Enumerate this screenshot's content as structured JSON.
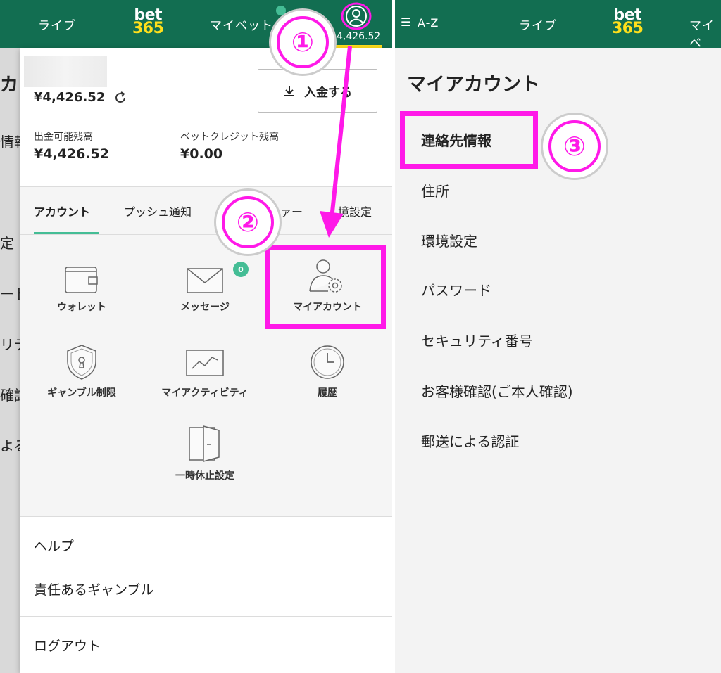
{
  "left": {
    "nav": {
      "live": "ライブ",
      "mybets": "マイベット",
      "logo_top": "bet",
      "logo_bottom": "365",
      "balance": "4,426.52"
    },
    "background_text": [
      "カウ",
      "情報",
      "定",
      "ード",
      "リテ",
      "確認",
      "よる"
    ],
    "panel": {
      "main_balance": "¥4,426.52",
      "deposit_label": "入金する",
      "withdrawable_label": "出金可能残高",
      "withdrawable_value": "¥4,426.52",
      "bet_credit_label": "ベットクレジット残高",
      "bet_credit_value": "¥0.00",
      "tabs": [
        "アカウント",
        "プッシュ通知",
        "ァー",
        "境設定"
      ],
      "tiles": {
        "wallet": "ウォレット",
        "messages": "メッセージ",
        "message_count": "0",
        "my_account": "マイアカウント",
        "gambling_limits": "ギャンブル制限",
        "my_activity": "マイアクティビティ",
        "history": "履歴",
        "time_out": "一時休止設定"
      },
      "help": "ヘルプ",
      "responsible_gambling": "責任あるギャンブル",
      "logout": "ログアウト"
    }
  },
  "right": {
    "nav": {
      "az": "A-Z",
      "live": "ライブ",
      "logo_top": "bet",
      "logo_bottom": "365",
      "mybets": "マイベ"
    },
    "title": "マイアカウント",
    "items": [
      "連絡先情報",
      "住所",
      "環境設定",
      "パスワード",
      "セキュリティ番号",
      "お客様確認(ご本人確認)",
      "郵送による認証"
    ]
  },
  "annotations": {
    "step1": "①",
    "step2": "②",
    "step3": "③"
  },
  "colors": {
    "header_green": "#126e51",
    "accent_green": "#44bd95",
    "logo_yellow": "#ffdf1b",
    "highlight_magenta": "#ff19e8"
  }
}
